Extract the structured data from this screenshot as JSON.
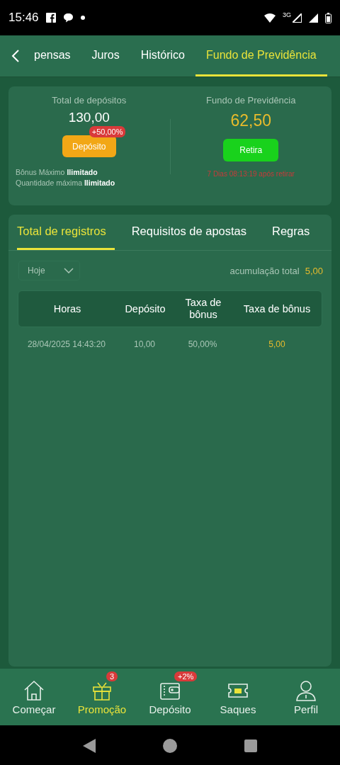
{
  "status_bar": {
    "time": "15:46",
    "network": "3G"
  },
  "top_tabs": [
    {
      "label": "pensas",
      "selected": false
    },
    {
      "label": "Juros",
      "selected": false
    },
    {
      "label": "Histórico",
      "selected": false
    },
    {
      "label": "Fundo de Previdência",
      "selected": true
    }
  ],
  "summary": {
    "deposits_label": "Total de depósitos",
    "deposits_value": "130,00",
    "deposit_badge": "+50,00%",
    "deposit_button": "Depósito",
    "max_bonus_label": "Bônus Máximo",
    "max_bonus_value": "Ilimitado",
    "max_qty_label": "Quantidade máxima",
    "max_qty_value": "Ilimitado",
    "fund_label": "Fundo de Previdência",
    "fund_value": "62,50",
    "withdraw_button": "Retira",
    "countdown": "7 Dias 08:13:19 após retirar"
  },
  "record_tabs": [
    {
      "label": "Total de registros",
      "selected": true
    },
    {
      "label": "Requisitos de apostas",
      "selected": false
    },
    {
      "label": "Regras",
      "selected": false
    }
  ],
  "filter": {
    "value": "Hoje"
  },
  "total": {
    "label": "acumulação total",
    "value": "5,00"
  },
  "table": {
    "columns": [
      "Horas",
      "Depósito",
      "Taxa de bônus",
      "Taxa de bônus"
    ],
    "rows": [
      [
        "28/04/2025 14:43:20",
        "10,00",
        "50,00%",
        "5,00"
      ]
    ]
  },
  "bottom_nav": [
    {
      "label": "Começar",
      "selected": false
    },
    {
      "label": "Promoção",
      "selected": true,
      "badge": "3"
    },
    {
      "label": "Depósito",
      "selected": false,
      "badge": "+2%"
    },
    {
      "label": "Saques",
      "selected": false
    },
    {
      "label": "Perfil",
      "selected": false
    }
  ]
}
